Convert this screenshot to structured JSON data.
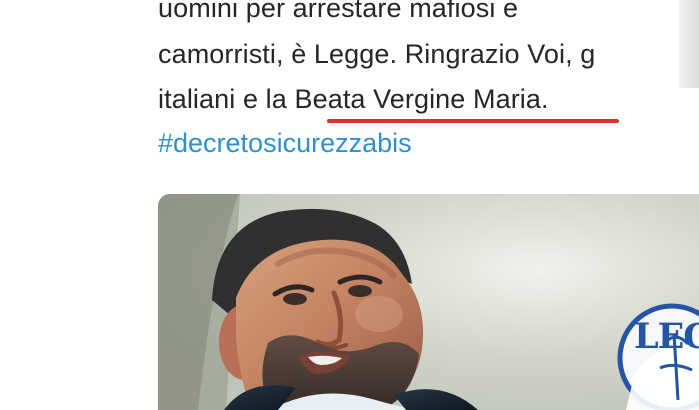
{
  "tweet": {
    "lines": [
      "uomini per arrestare mafiosi e",
      "camorristi, è Legge. Ringrazio Voi, g",
      "italiani e la Beata Vergine Maria."
    ],
    "hashtag": "#decretosicurezzabis"
  },
  "media": {
    "logo_text": "LEG",
    "logo_color": "#2354a6",
    "accent_color": "#d7322e",
    "hashtag_color": "#2f8fcf"
  }
}
